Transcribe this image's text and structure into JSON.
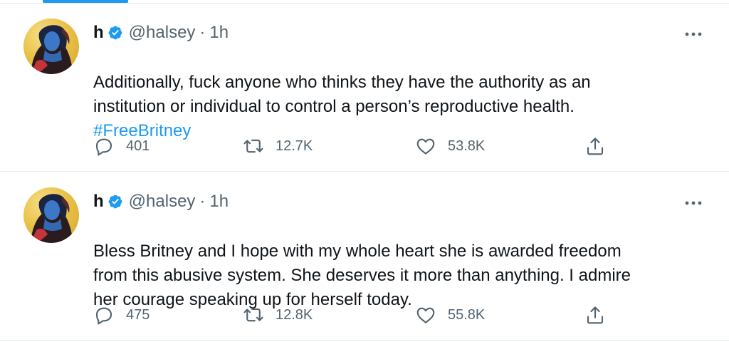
{
  "tweets": [
    {
      "name": "h",
      "handle": "@halsey",
      "separator": "·",
      "time": "1h",
      "text": "Additionally, fuck anyone who thinks they have the authority as an\ninstitution or individual to control a person’s reproductive health.",
      "hashtag": "#FreeBritney",
      "replies": "401",
      "retweets": "12.7K",
      "likes": "53.8K"
    },
    {
      "name": "h",
      "handle": "@halsey",
      "separator": "·",
      "time": "1h",
      "text": "Bless Britney and I hope with my whole heart she is awarded freedom\nfrom this abusive system. She deserves it more than anything. I admire\nher courage speaking up for herself today.",
      "hashtag": "",
      "replies": "475",
      "retweets": "12.8K",
      "likes": "55.8K"
    }
  ],
  "icons": {
    "verified": "verified-badge-icon",
    "more": "more-horizontal-icon",
    "reply": "comment-bubble-icon",
    "retweet": "retweet-arrows-icon",
    "like": "heart-icon",
    "share": "share-upload-icon"
  },
  "colors": {
    "accent": "#1d9bf0",
    "text": "#0f1419",
    "muted": "#536471",
    "border": "#e6ecf0"
  }
}
